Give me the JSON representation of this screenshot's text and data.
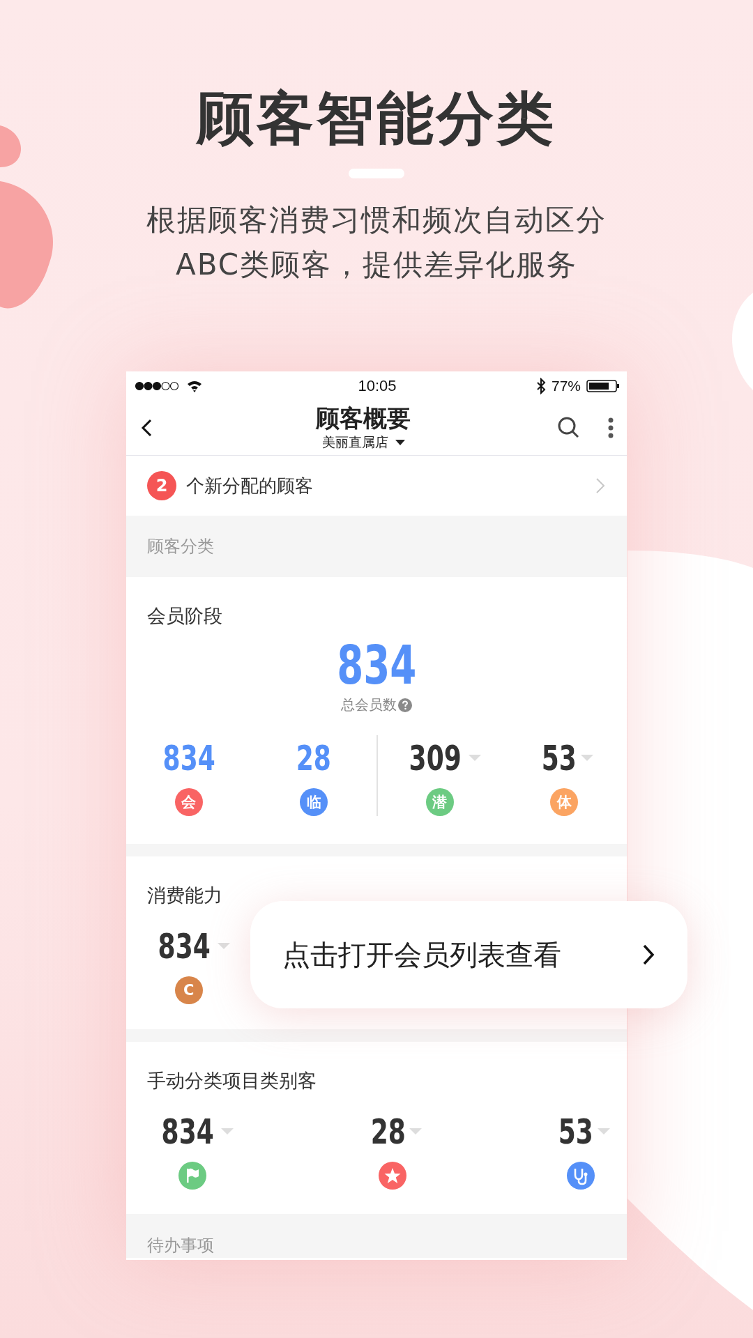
{
  "headline": "顾客智能分类",
  "subtitle_lines": [
    "根据顾客消费习惯和频次自动区分",
    "ABC类顾客，提供差异化服务"
  ],
  "status_bar": {
    "time": "10:05",
    "battery": "77%"
  },
  "nav": {
    "title": "顾客概要",
    "store": "美丽直属店"
  },
  "notice": {
    "count": "2",
    "text": "个新分配的顾客"
  },
  "section_header": "顾客分类",
  "stage": {
    "title": "会员阶段",
    "total": "834",
    "total_label": "总会员数",
    "groups": [
      [
        {
          "value": "834",
          "dropdown": false,
          "badge": "会",
          "color": "#f96464"
        },
        {
          "value": "28",
          "dropdown": false,
          "badge": "临",
          "color": "#5590f8"
        }
      ],
      [
        {
          "value": "309",
          "dropdown": true,
          "badge": "潜",
          "color": "#6ccb82"
        },
        {
          "value": "53",
          "dropdown": true,
          "badge": "体",
          "color": "#fba462"
        }
      ]
    ]
  },
  "spending": {
    "title": "消费能力",
    "items": [
      {
        "value": "834",
        "dropdown": true,
        "badge": "C",
        "color": "#d8854a"
      }
    ]
  },
  "manual": {
    "title": "手动分类项目类别客",
    "items": [
      {
        "value": "834",
        "dropdown": true,
        "kind": "flag",
        "color": "#6ccb82"
      },
      {
        "value": "28",
        "dropdown": true,
        "kind": "star",
        "color": "#f96464"
      },
      {
        "value": "53",
        "dropdown": true,
        "kind": "stethoscope",
        "color": "#5590f8"
      }
    ]
  },
  "todo_header": "待办事项",
  "popup": {
    "text": "点击打开会员列表查看"
  }
}
